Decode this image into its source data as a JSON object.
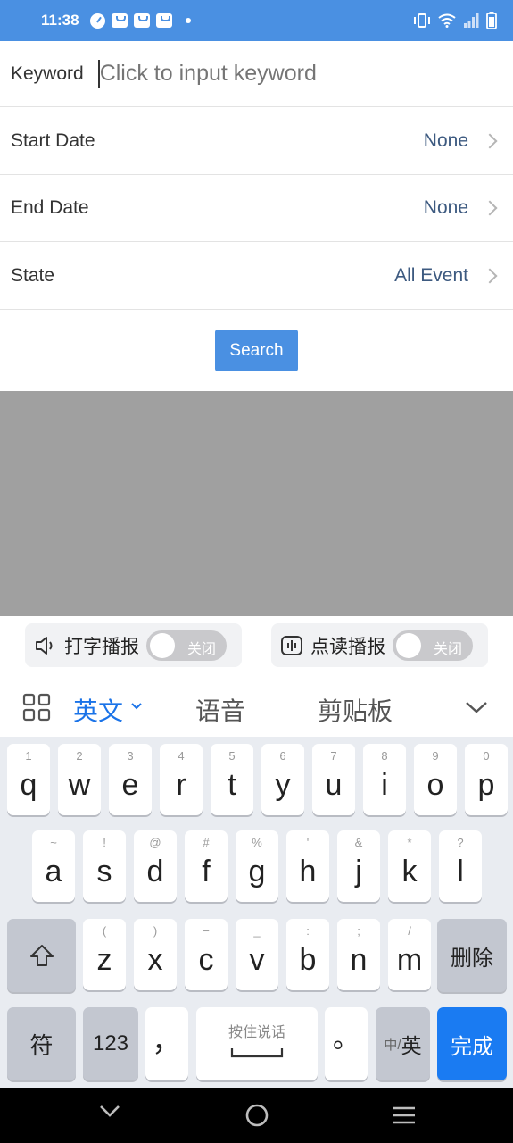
{
  "status_bar": {
    "time": "11:38"
  },
  "form": {
    "keyword_label": "Keyword",
    "keyword_placeholder": "Click to input keyword",
    "start_date_label": "Start Date",
    "start_date_value": "None",
    "end_date_label": "End Date",
    "end_date_value": "None",
    "state_label": "State",
    "state_value": "All Event",
    "search_label": "Search"
  },
  "keyboard": {
    "typing_broadcast": "打字播报",
    "tap_broadcast": "点读播报",
    "toggle_off": "关闭",
    "tab_english": "英文",
    "tab_voice": "语音",
    "tab_clipboard": "剪贴板",
    "row1": [
      {
        "k": "q",
        "s": "1"
      },
      {
        "k": "w",
        "s": "2"
      },
      {
        "k": "e",
        "s": "3"
      },
      {
        "k": "r",
        "s": "4"
      },
      {
        "k": "t",
        "s": "5"
      },
      {
        "k": "y",
        "s": "6"
      },
      {
        "k": "u",
        "s": "7"
      },
      {
        "k": "i",
        "s": "8"
      },
      {
        "k": "o",
        "s": "9"
      },
      {
        "k": "p",
        "s": "0"
      }
    ],
    "row2": [
      {
        "k": "a",
        "s": "~"
      },
      {
        "k": "s",
        "s": "!"
      },
      {
        "k": "d",
        "s": "@"
      },
      {
        "k": "f",
        "s": "#"
      },
      {
        "k": "g",
        "s": "%"
      },
      {
        "k": "h",
        "s": "'"
      },
      {
        "k": "j",
        "s": "&"
      },
      {
        "k": "k",
        "s": "*"
      },
      {
        "k": "l",
        "s": "?"
      }
    ],
    "row3": [
      {
        "k": "z",
        "s": "("
      },
      {
        "k": "x",
        "s": ")"
      },
      {
        "k": "c",
        "s": "−"
      },
      {
        "k": "v",
        "s": "_"
      },
      {
        "k": "b",
        "s": ":"
      },
      {
        "k": "n",
        "s": ";"
      },
      {
        "k": "m",
        "s": "/"
      }
    ],
    "delete": "删除",
    "symbol": "符",
    "numbers": "123",
    "comma": "，",
    "space_hint": "按住说话",
    "period": "。",
    "lang_switch_small": "中/",
    "lang_switch_big": "英",
    "done": "完成"
  }
}
